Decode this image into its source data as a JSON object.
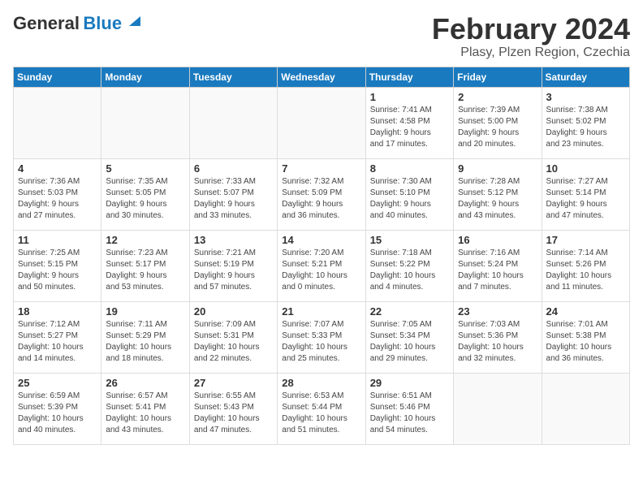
{
  "header": {
    "logo_line1": "General",
    "logo_line2": "Blue",
    "month": "February 2024",
    "location": "Plasy, Plzen Region, Czechia"
  },
  "weekdays": [
    "Sunday",
    "Monday",
    "Tuesday",
    "Wednesday",
    "Thursday",
    "Friday",
    "Saturday"
  ],
  "weeks": [
    [
      {
        "day": "",
        "info": ""
      },
      {
        "day": "",
        "info": ""
      },
      {
        "day": "",
        "info": ""
      },
      {
        "day": "",
        "info": ""
      },
      {
        "day": "1",
        "info": "Sunrise: 7:41 AM\nSunset: 4:58 PM\nDaylight: 9 hours\nand 17 minutes."
      },
      {
        "day": "2",
        "info": "Sunrise: 7:39 AM\nSunset: 5:00 PM\nDaylight: 9 hours\nand 20 minutes."
      },
      {
        "day": "3",
        "info": "Sunrise: 7:38 AM\nSunset: 5:02 PM\nDaylight: 9 hours\nand 23 minutes."
      }
    ],
    [
      {
        "day": "4",
        "info": "Sunrise: 7:36 AM\nSunset: 5:03 PM\nDaylight: 9 hours\nand 27 minutes."
      },
      {
        "day": "5",
        "info": "Sunrise: 7:35 AM\nSunset: 5:05 PM\nDaylight: 9 hours\nand 30 minutes."
      },
      {
        "day": "6",
        "info": "Sunrise: 7:33 AM\nSunset: 5:07 PM\nDaylight: 9 hours\nand 33 minutes."
      },
      {
        "day": "7",
        "info": "Sunrise: 7:32 AM\nSunset: 5:09 PM\nDaylight: 9 hours\nand 36 minutes."
      },
      {
        "day": "8",
        "info": "Sunrise: 7:30 AM\nSunset: 5:10 PM\nDaylight: 9 hours\nand 40 minutes."
      },
      {
        "day": "9",
        "info": "Sunrise: 7:28 AM\nSunset: 5:12 PM\nDaylight: 9 hours\nand 43 minutes."
      },
      {
        "day": "10",
        "info": "Sunrise: 7:27 AM\nSunset: 5:14 PM\nDaylight: 9 hours\nand 47 minutes."
      }
    ],
    [
      {
        "day": "11",
        "info": "Sunrise: 7:25 AM\nSunset: 5:15 PM\nDaylight: 9 hours\nand 50 minutes."
      },
      {
        "day": "12",
        "info": "Sunrise: 7:23 AM\nSunset: 5:17 PM\nDaylight: 9 hours\nand 53 minutes."
      },
      {
        "day": "13",
        "info": "Sunrise: 7:21 AM\nSunset: 5:19 PM\nDaylight: 9 hours\nand 57 minutes."
      },
      {
        "day": "14",
        "info": "Sunrise: 7:20 AM\nSunset: 5:21 PM\nDaylight: 10 hours\nand 0 minutes."
      },
      {
        "day": "15",
        "info": "Sunrise: 7:18 AM\nSunset: 5:22 PM\nDaylight: 10 hours\nand 4 minutes."
      },
      {
        "day": "16",
        "info": "Sunrise: 7:16 AM\nSunset: 5:24 PM\nDaylight: 10 hours\nand 7 minutes."
      },
      {
        "day": "17",
        "info": "Sunrise: 7:14 AM\nSunset: 5:26 PM\nDaylight: 10 hours\nand 11 minutes."
      }
    ],
    [
      {
        "day": "18",
        "info": "Sunrise: 7:12 AM\nSunset: 5:27 PM\nDaylight: 10 hours\nand 14 minutes."
      },
      {
        "day": "19",
        "info": "Sunrise: 7:11 AM\nSunset: 5:29 PM\nDaylight: 10 hours\nand 18 minutes."
      },
      {
        "day": "20",
        "info": "Sunrise: 7:09 AM\nSunset: 5:31 PM\nDaylight: 10 hours\nand 22 minutes."
      },
      {
        "day": "21",
        "info": "Sunrise: 7:07 AM\nSunset: 5:33 PM\nDaylight: 10 hours\nand 25 minutes."
      },
      {
        "day": "22",
        "info": "Sunrise: 7:05 AM\nSunset: 5:34 PM\nDaylight: 10 hours\nand 29 minutes."
      },
      {
        "day": "23",
        "info": "Sunrise: 7:03 AM\nSunset: 5:36 PM\nDaylight: 10 hours\nand 32 minutes."
      },
      {
        "day": "24",
        "info": "Sunrise: 7:01 AM\nSunset: 5:38 PM\nDaylight: 10 hours\nand 36 minutes."
      }
    ],
    [
      {
        "day": "25",
        "info": "Sunrise: 6:59 AM\nSunset: 5:39 PM\nDaylight: 10 hours\nand 40 minutes."
      },
      {
        "day": "26",
        "info": "Sunrise: 6:57 AM\nSunset: 5:41 PM\nDaylight: 10 hours\nand 43 minutes."
      },
      {
        "day": "27",
        "info": "Sunrise: 6:55 AM\nSunset: 5:43 PM\nDaylight: 10 hours\nand 47 minutes."
      },
      {
        "day": "28",
        "info": "Sunrise: 6:53 AM\nSunset: 5:44 PM\nDaylight: 10 hours\nand 51 minutes."
      },
      {
        "day": "29",
        "info": "Sunrise: 6:51 AM\nSunset: 5:46 PM\nDaylight: 10 hours\nand 54 minutes."
      },
      {
        "day": "",
        "info": ""
      },
      {
        "day": "",
        "info": ""
      }
    ]
  ]
}
